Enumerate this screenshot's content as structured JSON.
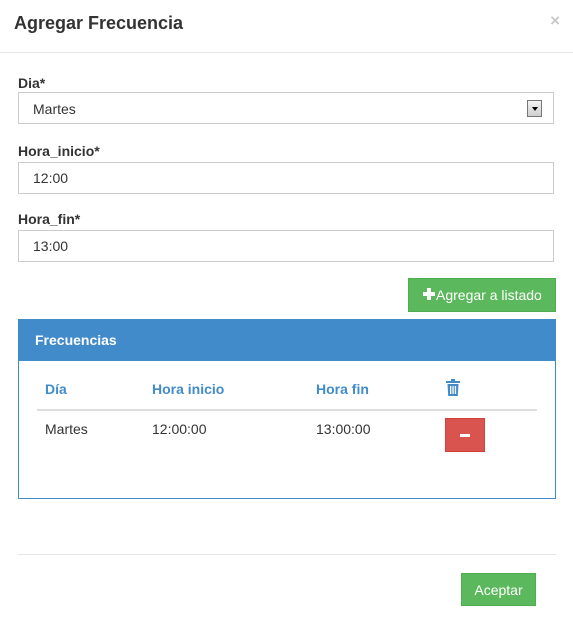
{
  "modal": {
    "title": "Agregar Frecuencia",
    "close": "×"
  },
  "form": {
    "dia_label": "Dia*",
    "dia_value": "Martes",
    "hora_inicio_label": "Hora_inicio*",
    "hora_inicio_value": "12:00",
    "hora_fin_label": "Hora_fin*",
    "hora_fin_value": "13:00",
    "add_button": "Agregar a listado"
  },
  "panel": {
    "title": "Frecuencias",
    "columns": [
      "Día",
      "Hora inicio",
      "Hora fin"
    ],
    "header_icon": "trash-icon",
    "rows": [
      {
        "dia": "Martes",
        "hora_inicio": "12:00:00",
        "hora_fin": "13:00:00",
        "action_icon": "minus-icon"
      }
    ]
  },
  "footer": {
    "accept_button": "Aceptar"
  },
  "colors": {
    "primary": "#428bca",
    "success": "#5cb85c",
    "danger": "#d9534f"
  }
}
